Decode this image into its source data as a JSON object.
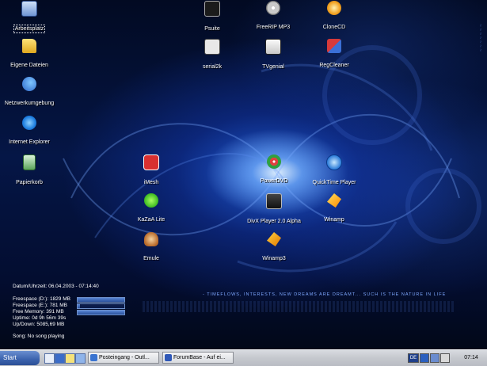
{
  "desktop_icons": {
    "arbeitsplatz": "Arbeitsplatz",
    "eigene_dateien": "Eigene Dateien",
    "netzwerkumgebung": "Netzwerkumgebung",
    "internet_explorer": "Internet Explorer",
    "papierkorb": "Papierkorb",
    "psuite": "Psuite",
    "serial2k": "serial2k",
    "freerip": "FreeRIP MP3",
    "tvgenial": "TVgenial",
    "clonecd": "CloneCD",
    "regcleaner": "RegCleaner",
    "imesh": "iMesh",
    "kazaa": "KaZaA Lite",
    "emule": "Emule",
    "powerdvd": "PowerDVD",
    "divx": "DivX Player 2.0 Alpha",
    "winamp3": "Winamp3",
    "quicktime": "QuickTime Player",
    "winamp": "Winamp"
  },
  "sysinfo": {
    "datetime": "Datum/Uhrzeit: 06.04.2003 - 07:14:40",
    "freespace_d": "Freespace (D:): 1829 MB",
    "freespace_e": "Freespace (E:): 781 MB",
    "free_memory": "Free Memory: 391 MB",
    "uptime": "Uptime: 0d 9h 56m 39s",
    "updown": "Up/Down: 5085,69 MB",
    "song": "Song: No song playing",
    "bar_d_fraction": 1.0,
    "bar_e_fraction": 0.05,
    "bar_mem_fraction": 1.0
  },
  "wallpaper": {
    "tagline": "- TIMEFLOWS, INTERESTS, NEW DREAMS ARE DREAMT... SUCH IS THE NATURE IN LIFE"
  },
  "taskbar": {
    "start_label": "Start",
    "tasks": [
      "Posteingang - Outl...",
      "ForumBase - Auf ei..."
    ],
    "tray_lang": "DE",
    "clock": "07:14"
  },
  "colors": {
    "desktop_blue": "#0a2a7a",
    "taskbar_gray": "#c5c8ce",
    "start_blue": "#3b62ad"
  }
}
